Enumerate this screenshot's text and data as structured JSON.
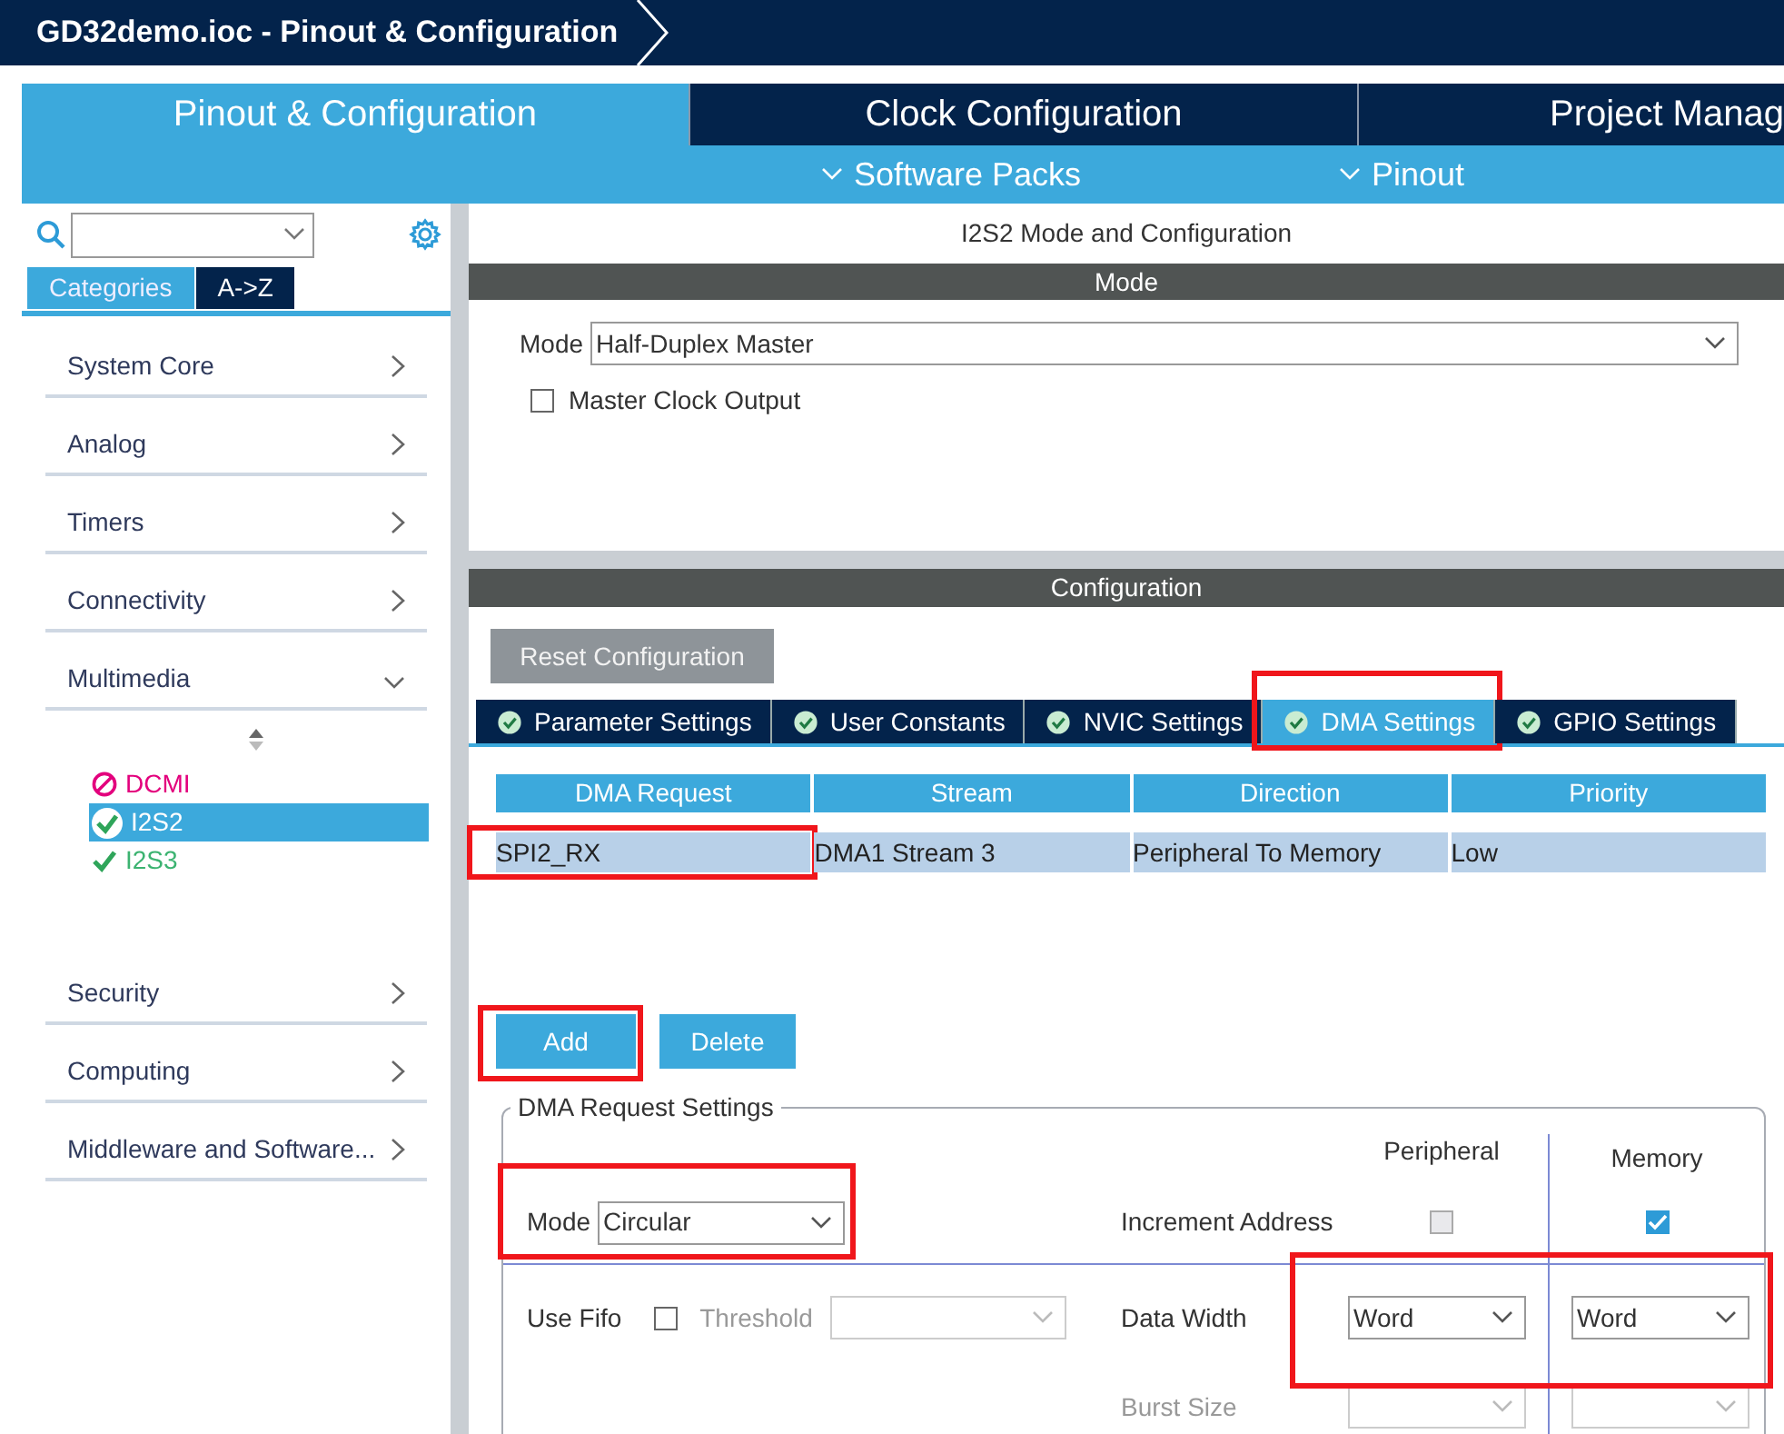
{
  "window": {
    "title": "GD32demo.ioc - Pinout & Configuration"
  },
  "main_tabs": [
    {
      "label": "Pinout & Configuration",
      "selected": true
    },
    {
      "label": "Clock Configuration",
      "selected": false
    },
    {
      "label": "Project Manag",
      "selected": false
    }
  ],
  "sub_menu": [
    {
      "label": "Software Packs"
    },
    {
      "label": "Pinout"
    }
  ],
  "sidebar": {
    "view_tabs": [
      {
        "label": "Categories",
        "selected": true
      },
      {
        "label": "A->Z",
        "selected": false
      }
    ],
    "categories": [
      {
        "label": "System Core",
        "expanded": false
      },
      {
        "label": "Analog",
        "expanded": false
      },
      {
        "label": "Timers",
        "expanded": false
      },
      {
        "label": "Connectivity",
        "expanded": false
      },
      {
        "label": "Multimedia",
        "expanded": true,
        "children": [
          {
            "label": "DCMI",
            "kind": "unavailable",
            "selected": false
          },
          {
            "label": "I2S2",
            "kind": "configured",
            "selected": true
          },
          {
            "label": "I2S3",
            "kind": "configured",
            "selected": false
          }
        ]
      },
      {
        "label": "Security",
        "expanded": false
      },
      {
        "label": "Computing",
        "expanded": false
      },
      {
        "label": "Middleware and Software...",
        "expanded": false
      }
    ]
  },
  "panel": {
    "title": "I2S2 Mode and Configuration",
    "mode_section": {
      "header": "Mode",
      "mode_label": "Mode",
      "mode_value": "Half-Duplex Master",
      "master_clock": {
        "label": "Master Clock Output",
        "checked": false
      }
    },
    "config": {
      "header": "Configuration",
      "reset_button": "Reset Configuration",
      "tabs": [
        {
          "label": "Parameter Settings",
          "selected": false
        },
        {
          "label": "User Constants",
          "selected": false
        },
        {
          "label": "NVIC Settings",
          "selected": false
        },
        {
          "label": "DMA Settings",
          "selected": true,
          "highlighted": true
        },
        {
          "label": "GPIO Settings",
          "selected": false
        }
      ],
      "dma_table": {
        "columns": [
          "DMA Request",
          "Stream",
          "Direction",
          "Priority"
        ],
        "rows": [
          {
            "cells": [
              "SPI2_RX",
              "DMA1 Stream 3",
              "Peripheral To Memory",
              "Low"
            ],
            "selected": true,
            "first_cell_highlighted": true
          }
        ]
      },
      "add_button": {
        "label": "Add",
        "highlighted": true
      },
      "delete_button": {
        "label": "Delete"
      },
      "request_settings": {
        "title": "DMA Request Settings",
        "peripheral_header": "Peripheral",
        "memory_header": "Memory",
        "mode": {
          "label": "Mode",
          "value": "Circular",
          "highlighted": true
        },
        "increment_address": {
          "label": "Increment Address",
          "peripheral": {
            "checked": false,
            "disabled": true
          },
          "memory": {
            "checked": true
          }
        },
        "use_fifo": {
          "label": "Use Fifo",
          "checked": false
        },
        "threshold": {
          "label": "Threshold",
          "disabled": true
        },
        "data_width": {
          "label": "Data Width",
          "peripheral": "Word",
          "memory": "Word",
          "highlighted": true
        },
        "burst_size": {
          "label": "Burst Size",
          "disabled": true
        }
      }
    }
  }
}
